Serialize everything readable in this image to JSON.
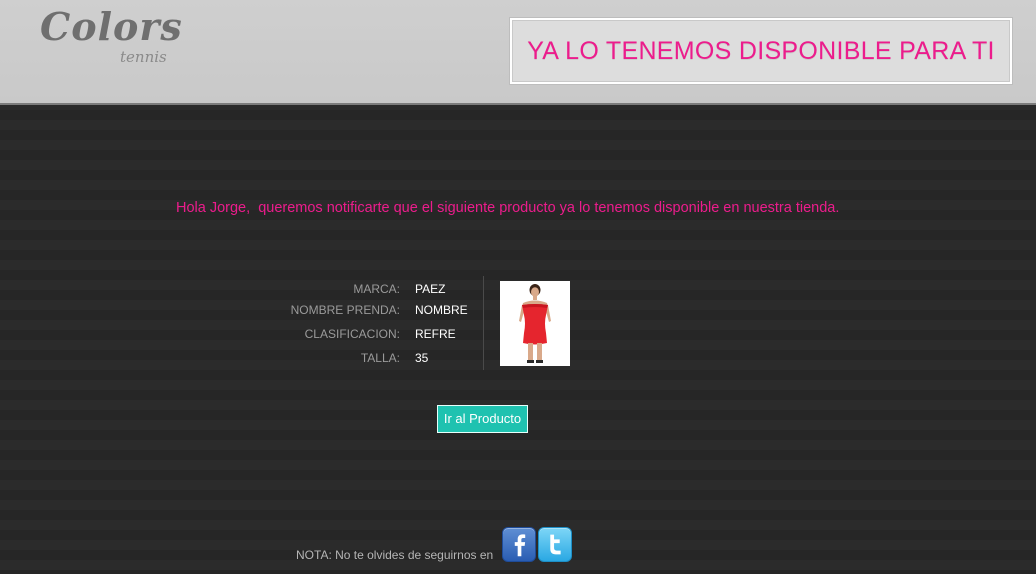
{
  "header": {
    "logo": {
      "main": "Colors",
      "sub": "tennis"
    },
    "banner_text": "YA LO TENEMOS DISPONIBLE PARA TI"
  },
  "message": {
    "greeting": "Hola Jorge,  queremos notificarte que el siguiente producto ya lo tenemos disponible en nuestra tienda."
  },
  "product": {
    "details": [
      {
        "label": "MARCA:",
        "value": "PAEZ"
      },
      {
        "label": "NOMBRE PRENDA:",
        "value": "NOMBRE"
      },
      {
        "label": "CLASIFICACION:",
        "value": "REFRE"
      },
      {
        "label": "TALLA:",
        "value": "35"
      }
    ],
    "image_subject": "woman-in-red-dress"
  },
  "cta": {
    "label": "Ir al Producto"
  },
  "footer": {
    "note": "NOTA: No te olvides de seguirnos en",
    "social": [
      {
        "icon": "facebook-icon"
      },
      {
        "icon": "twitter-icon"
      }
    ]
  },
  "colors": {
    "accent_pink": "#ec1c8c",
    "button_teal": "#1fc2b0",
    "header_bg": "#cfcfcf",
    "body_bg": "#2b2b2b"
  }
}
